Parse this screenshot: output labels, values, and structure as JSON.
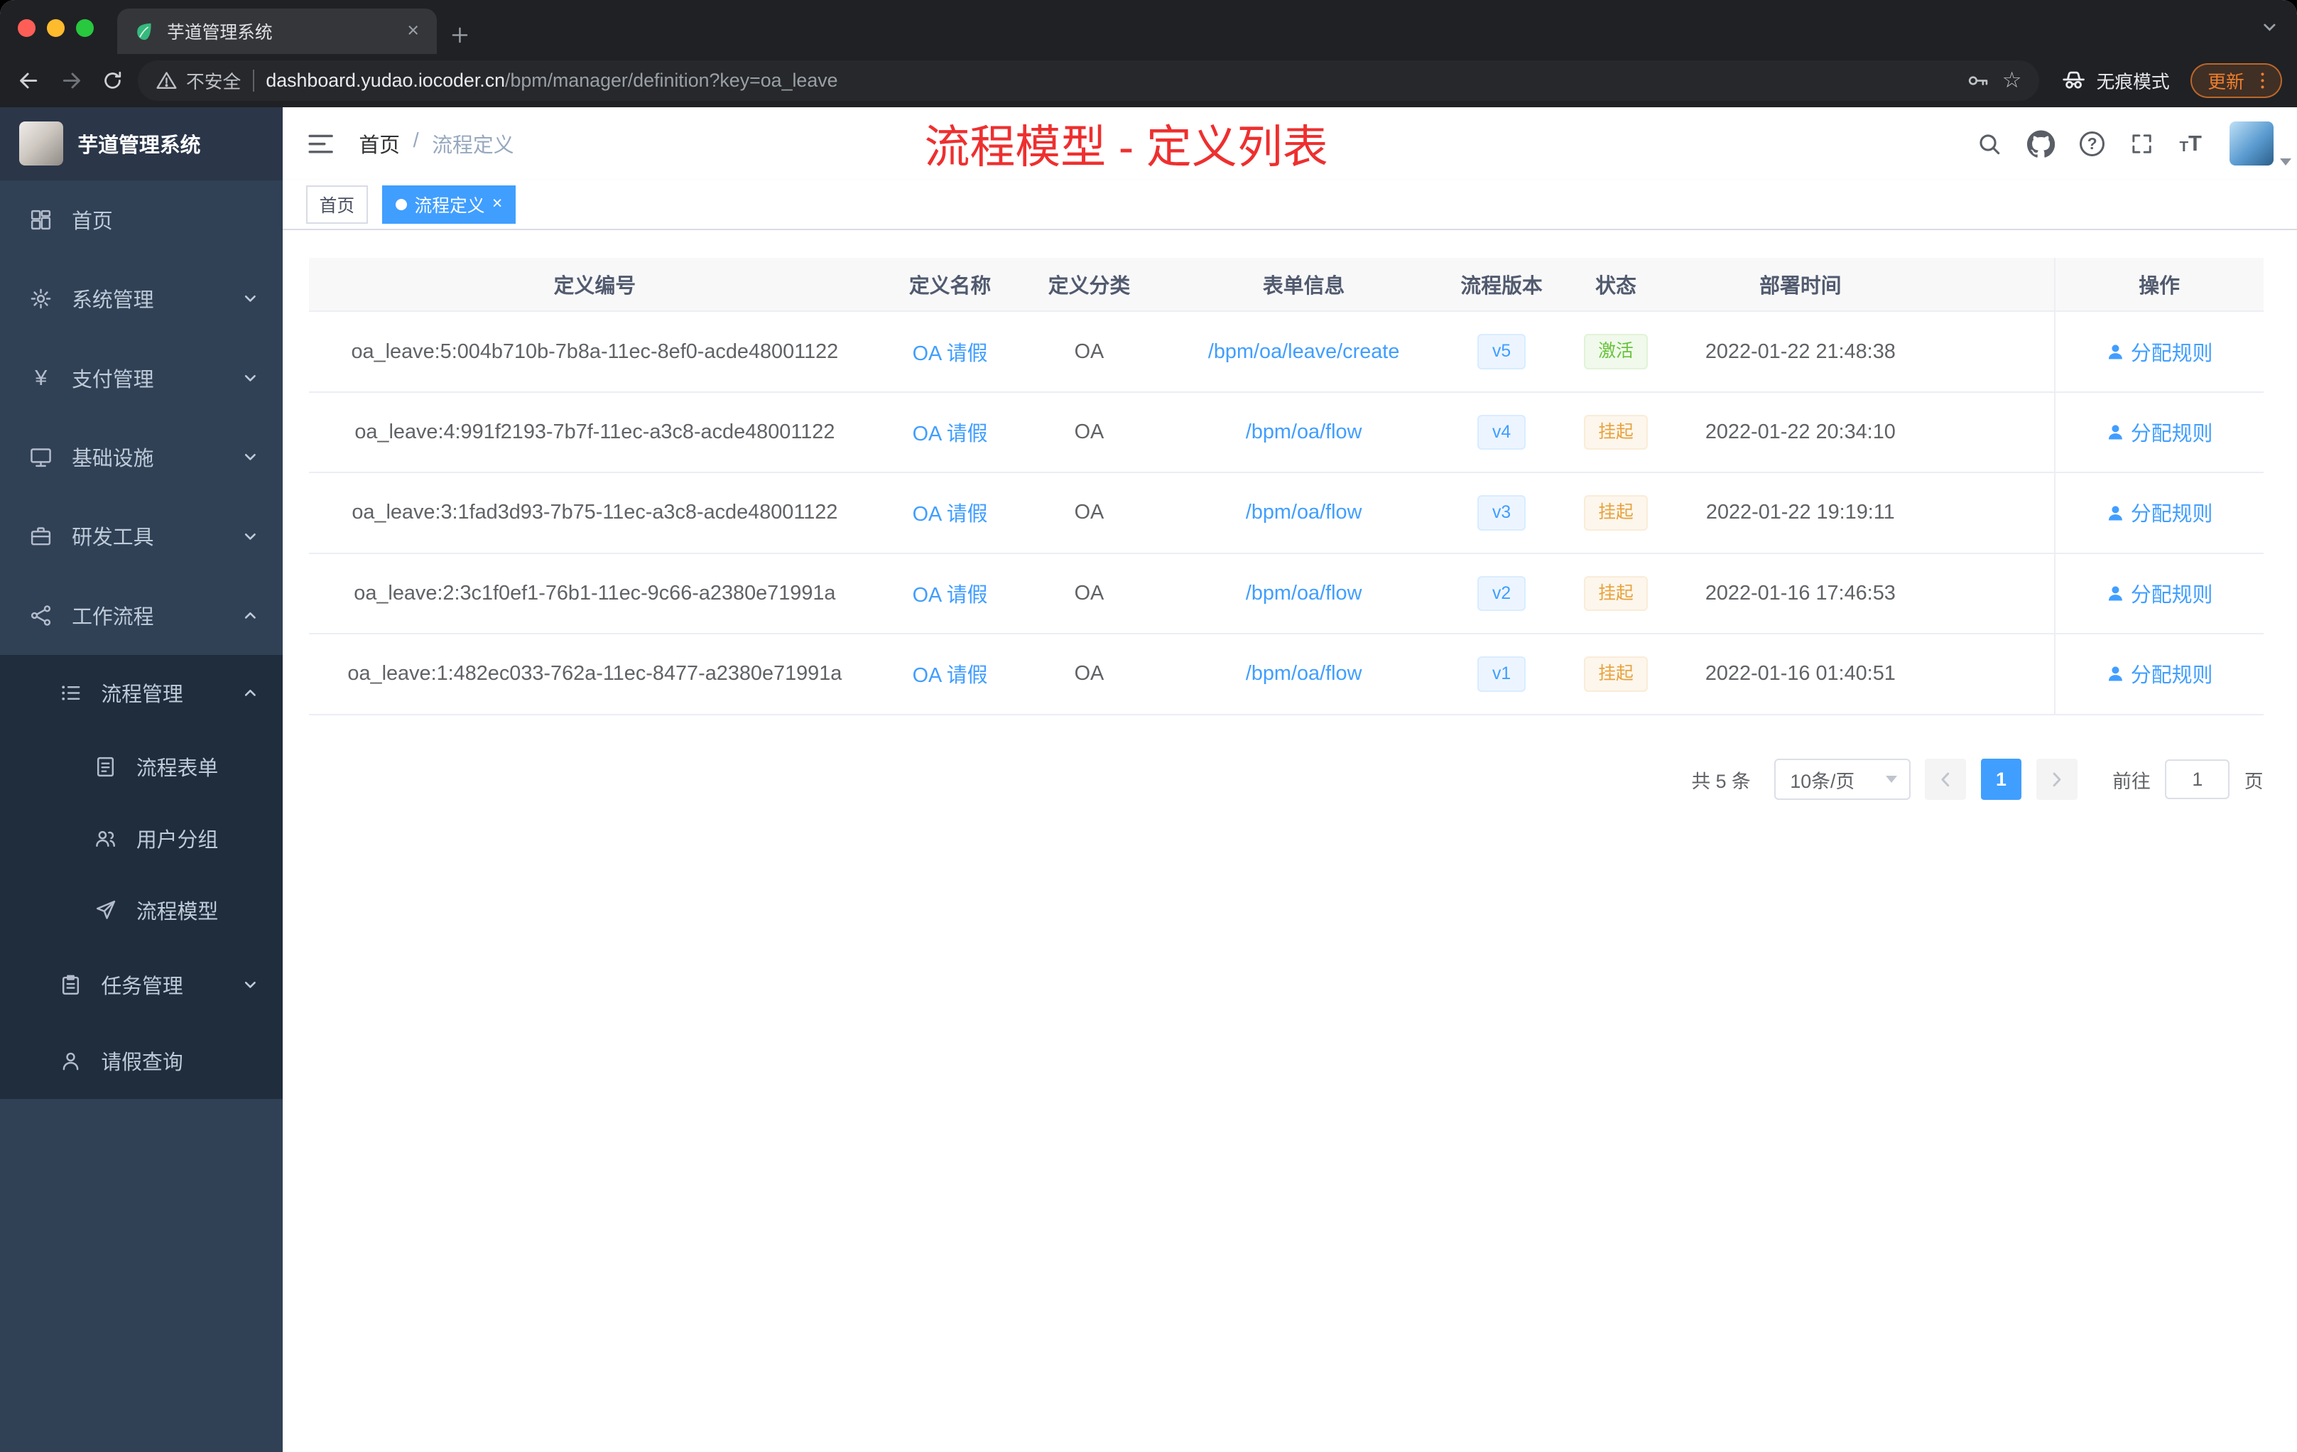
{
  "colors": {
    "primary": "#409eff",
    "success": "#67c23a",
    "warning": "#e6a23c",
    "sidebar": "#304156",
    "annotation": "#ee2f2f",
    "update": "#ee7f2d"
  },
  "browser": {
    "tab": {
      "title": "芋道管理系统"
    },
    "toolbar": {
      "security_label": "不安全",
      "url_host": "dashboard.yudao.iocoder.cn",
      "url_path": "/bpm/manager/definition?key=oa_leave",
      "incognito_label": "无痕模式",
      "update_label": "更新"
    }
  },
  "sidebar": {
    "logo_title": "芋道管理系统",
    "items": [
      {
        "key": "home",
        "label": "首页",
        "icon": "dashboard-icon",
        "level": 1
      },
      {
        "key": "system",
        "label": "系统管理",
        "icon": "gear-icon",
        "level": 1,
        "arrow": "down"
      },
      {
        "key": "payment",
        "label": "支付管理",
        "icon": "yen-icon",
        "level": 1,
        "arrow": "down"
      },
      {
        "key": "infra",
        "label": "基础设施",
        "icon": "infra-icon",
        "level": 1,
        "arrow": "down"
      },
      {
        "key": "devtools",
        "label": "研发工具",
        "icon": "tools-icon",
        "level": 1,
        "arrow": "down"
      },
      {
        "key": "workflow",
        "label": "工作流程",
        "icon": "workflow-icon",
        "level": 1,
        "arrow": "up"
      },
      {
        "key": "process-manage",
        "label": "流程管理",
        "icon": "process-icon",
        "level": 2,
        "arrow": "up",
        "dark": true
      },
      {
        "key": "process-form",
        "label": "流程表单",
        "icon": "form-icon",
        "level": 3,
        "dark": true
      },
      {
        "key": "user-group",
        "label": "用户分组",
        "icon": "group-icon",
        "level": 3,
        "dark": true
      },
      {
        "key": "process-model",
        "label": "流程模型",
        "icon": "model-icon",
        "level": 3,
        "dark": true
      },
      {
        "key": "task-manage",
        "label": "任务管理",
        "icon": "task-icon",
        "level": 2,
        "arrow": "down",
        "dark": true
      },
      {
        "key": "leave-query",
        "label": "请假查询",
        "icon": "leave-icon",
        "level": 2,
        "dark": true
      }
    ]
  },
  "header": {
    "breadcrumb": {
      "home": "首页",
      "separator": "/",
      "current": "流程定义"
    },
    "annotation": "流程模型 - 定义列表"
  },
  "tags": [
    {
      "label": "首页",
      "active": false,
      "closable": false
    },
    {
      "label": "流程定义",
      "active": true,
      "closable": true
    }
  ],
  "table": {
    "columns": [
      "定义编号",
      "定义名称",
      "定义分类",
      "表单信息",
      "流程版本",
      "状态",
      "部署时间",
      "操作"
    ],
    "action_label": "分配规则",
    "rows": [
      {
        "id": "oa_leave:5:004b710b-7b8a-11ec-8ef0-acde48001122",
        "name": "OA 请假",
        "category": "OA",
        "form": "/bpm/oa/leave/create",
        "version": "v5",
        "status": "激活",
        "status_type": "success",
        "time": "2022-01-22 21:48:38"
      },
      {
        "id": "oa_leave:4:991f2193-7b7f-11ec-a3c8-acde48001122",
        "name": "OA 请假",
        "category": "OA",
        "form": "/bpm/oa/flow",
        "version": "v4",
        "status": "挂起",
        "status_type": "warning",
        "time": "2022-01-22 20:34:10"
      },
      {
        "id": "oa_leave:3:1fad3d93-7b75-11ec-a3c8-acde48001122",
        "name": "OA 请假",
        "category": "OA",
        "form": "/bpm/oa/flow",
        "version": "v3",
        "status": "挂起",
        "status_type": "warning",
        "time": "2022-01-22 19:19:11"
      },
      {
        "id": "oa_leave:2:3c1f0ef1-76b1-11ec-9c66-a2380e71991a",
        "name": "OA 请假",
        "category": "OA",
        "form": "/bpm/oa/flow",
        "version": "v2",
        "status": "挂起",
        "status_type": "warning",
        "time": "2022-01-16 17:46:53"
      },
      {
        "id": "oa_leave:1:482ec033-762a-11ec-8477-a2380e71991a",
        "name": "OA 请假",
        "category": "OA",
        "form": "/bpm/oa/flow",
        "version": "v1",
        "status": "挂起",
        "status_type": "warning",
        "time": "2022-01-16 01:40:51"
      }
    ]
  },
  "pagination": {
    "total": "共 5 条",
    "page_size": "10条/页",
    "current": "1",
    "goto": "前往",
    "goto_value": "1",
    "unit": "页"
  }
}
